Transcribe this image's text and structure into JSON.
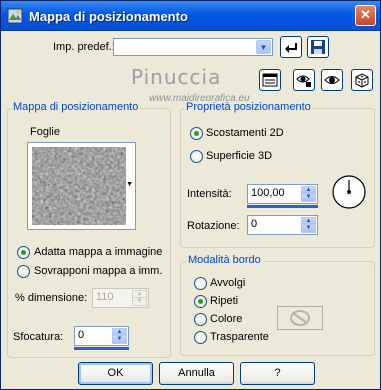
{
  "window": {
    "title": "Mappa di posizionamento"
  },
  "preset": {
    "label": "Imp. predef.:",
    "value": ""
  },
  "watermark": {
    "name": "Pinuccia",
    "url": "www.maidiregrafica.eu"
  },
  "map_group": {
    "title": "Mappa di posizionamento",
    "map_name": "Foglie",
    "fit_option": "Adatta mappa a immagine",
    "tile_option": "Sovrapponi mappa a imm.",
    "size_label": "% dimensione:",
    "size_value": "110",
    "blur_label": "Sfocatura:",
    "blur_value": "0"
  },
  "properties_group": {
    "title": "Proprietà posizionamento",
    "option_2d": "Scostamenti 2D",
    "option_3d": "Superficie 3D",
    "intensity_label": "Intensità:",
    "intensity_value": "100,00",
    "rotation_label": "Rotazione:",
    "rotation_value": "0"
  },
  "edge_group": {
    "title": "Modalità bordo",
    "wrap": "Avvolgi",
    "repeat": "Ripeti",
    "color": "Colore",
    "transparent": "Trasparente"
  },
  "buttons": {
    "ok": "OK",
    "cancel": "Annulla",
    "help": "?"
  },
  "colors": {
    "group_title": "#0046d5",
    "accent": "#2a60d9",
    "titlebar": "#0058e6"
  }
}
